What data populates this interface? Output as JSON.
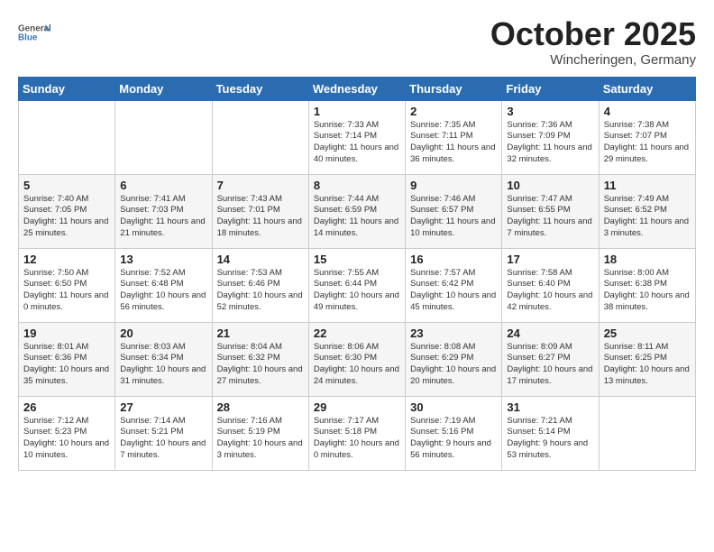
{
  "header": {
    "logo_general": "General",
    "logo_blue": "Blue",
    "month": "October 2025",
    "location": "Wincheringen, Germany"
  },
  "weekdays": [
    "Sunday",
    "Monday",
    "Tuesday",
    "Wednesday",
    "Thursday",
    "Friday",
    "Saturday"
  ],
  "weeks": [
    [
      {
        "day": "",
        "info": ""
      },
      {
        "day": "",
        "info": ""
      },
      {
        "day": "",
        "info": ""
      },
      {
        "day": "1",
        "info": "Sunrise: 7:33 AM\nSunset: 7:14 PM\nDaylight: 11 hours\nand 40 minutes."
      },
      {
        "day": "2",
        "info": "Sunrise: 7:35 AM\nSunset: 7:11 PM\nDaylight: 11 hours\nand 36 minutes."
      },
      {
        "day": "3",
        "info": "Sunrise: 7:36 AM\nSunset: 7:09 PM\nDaylight: 11 hours\nand 32 minutes."
      },
      {
        "day": "4",
        "info": "Sunrise: 7:38 AM\nSunset: 7:07 PM\nDaylight: 11 hours\nand 29 minutes."
      }
    ],
    [
      {
        "day": "5",
        "info": "Sunrise: 7:40 AM\nSunset: 7:05 PM\nDaylight: 11 hours\nand 25 minutes."
      },
      {
        "day": "6",
        "info": "Sunrise: 7:41 AM\nSunset: 7:03 PM\nDaylight: 11 hours\nand 21 minutes."
      },
      {
        "day": "7",
        "info": "Sunrise: 7:43 AM\nSunset: 7:01 PM\nDaylight: 11 hours\nand 18 minutes."
      },
      {
        "day": "8",
        "info": "Sunrise: 7:44 AM\nSunset: 6:59 PM\nDaylight: 11 hours\nand 14 minutes."
      },
      {
        "day": "9",
        "info": "Sunrise: 7:46 AM\nSunset: 6:57 PM\nDaylight: 11 hours\nand 10 minutes."
      },
      {
        "day": "10",
        "info": "Sunrise: 7:47 AM\nSunset: 6:55 PM\nDaylight: 11 hours\nand 7 minutes."
      },
      {
        "day": "11",
        "info": "Sunrise: 7:49 AM\nSunset: 6:52 PM\nDaylight: 11 hours\nand 3 minutes."
      }
    ],
    [
      {
        "day": "12",
        "info": "Sunrise: 7:50 AM\nSunset: 6:50 PM\nDaylight: 11 hours\nand 0 minutes."
      },
      {
        "day": "13",
        "info": "Sunrise: 7:52 AM\nSunset: 6:48 PM\nDaylight: 10 hours\nand 56 minutes."
      },
      {
        "day": "14",
        "info": "Sunrise: 7:53 AM\nSunset: 6:46 PM\nDaylight: 10 hours\nand 52 minutes."
      },
      {
        "day": "15",
        "info": "Sunrise: 7:55 AM\nSunset: 6:44 PM\nDaylight: 10 hours\nand 49 minutes."
      },
      {
        "day": "16",
        "info": "Sunrise: 7:57 AM\nSunset: 6:42 PM\nDaylight: 10 hours\nand 45 minutes."
      },
      {
        "day": "17",
        "info": "Sunrise: 7:58 AM\nSunset: 6:40 PM\nDaylight: 10 hours\nand 42 minutes."
      },
      {
        "day": "18",
        "info": "Sunrise: 8:00 AM\nSunset: 6:38 PM\nDaylight: 10 hours\nand 38 minutes."
      }
    ],
    [
      {
        "day": "19",
        "info": "Sunrise: 8:01 AM\nSunset: 6:36 PM\nDaylight: 10 hours\nand 35 minutes."
      },
      {
        "day": "20",
        "info": "Sunrise: 8:03 AM\nSunset: 6:34 PM\nDaylight: 10 hours\nand 31 minutes."
      },
      {
        "day": "21",
        "info": "Sunrise: 8:04 AM\nSunset: 6:32 PM\nDaylight: 10 hours\nand 27 minutes."
      },
      {
        "day": "22",
        "info": "Sunrise: 8:06 AM\nSunset: 6:30 PM\nDaylight: 10 hours\nand 24 minutes."
      },
      {
        "day": "23",
        "info": "Sunrise: 8:08 AM\nSunset: 6:29 PM\nDaylight: 10 hours\nand 20 minutes."
      },
      {
        "day": "24",
        "info": "Sunrise: 8:09 AM\nSunset: 6:27 PM\nDaylight: 10 hours\nand 17 minutes."
      },
      {
        "day": "25",
        "info": "Sunrise: 8:11 AM\nSunset: 6:25 PM\nDaylight: 10 hours\nand 13 minutes."
      }
    ],
    [
      {
        "day": "26",
        "info": "Sunrise: 7:12 AM\nSunset: 5:23 PM\nDaylight: 10 hours\nand 10 minutes."
      },
      {
        "day": "27",
        "info": "Sunrise: 7:14 AM\nSunset: 5:21 PM\nDaylight: 10 hours\nand 7 minutes."
      },
      {
        "day": "28",
        "info": "Sunrise: 7:16 AM\nSunset: 5:19 PM\nDaylight: 10 hours\nand 3 minutes."
      },
      {
        "day": "29",
        "info": "Sunrise: 7:17 AM\nSunset: 5:18 PM\nDaylight: 10 hours\nand 0 minutes."
      },
      {
        "day": "30",
        "info": "Sunrise: 7:19 AM\nSunset: 5:16 PM\nDaylight: 9 hours\nand 56 minutes."
      },
      {
        "day": "31",
        "info": "Sunrise: 7:21 AM\nSunset: 5:14 PM\nDaylight: 9 hours\nand 53 minutes."
      },
      {
        "day": "",
        "info": ""
      }
    ]
  ]
}
